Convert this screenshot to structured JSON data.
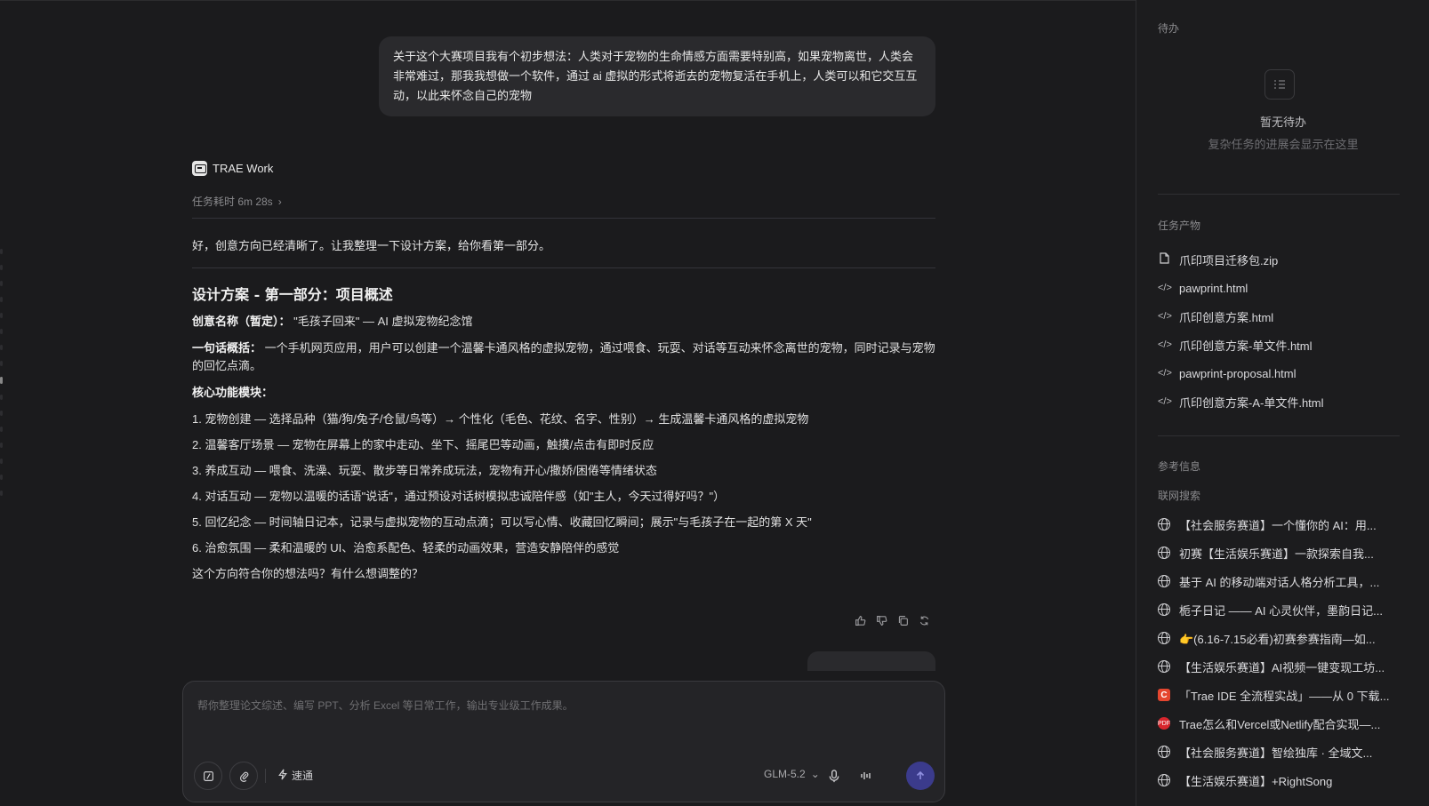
{
  "chat": {
    "user_message": "关于这个大赛项目我有个初步想法：人类对于宠物的生命情感方面需要特别高，如果宠物离世，人类会非常难过，那我我想做一个软件，通过 ai 虚拟的形式将逝去的宠物复活在手机上，人类可以和它交互互动，以此来怀念自己的宠物",
    "agent_name": "TRAE Work",
    "duration_label": "任务耗时 6m 28s",
    "intro": "好，创意方向已经清晰了。让我整理一下设计方案，给你看第一部分。",
    "doc": {
      "heading": "设计方案 - 第一部分：项目概述",
      "name_label": "创意名称（暂定）：",
      "name_value": " \"毛孩子回来\" — AI 虚拟宠物纪念馆",
      "summary_label": "一句话概括：",
      "summary_value": " 一个手机网页应用，用户可以创建一个温馨卡通风格的虚拟宠物，通过喂食、玩耍、对话等互动来怀念离世的宠物，同时记录与宠物的回忆点滴。",
      "modules_label": "核心功能模块：",
      "modules": [
        "1. 宠物创建 — 选择品种（猫/狗/兔子/仓鼠/鸟等）→ 个性化（毛色、花纹、名字、性别）→ 生成温馨卡通风格的虚拟宠物",
        "2. 温馨客厅场景 — 宠物在屏幕上的家中走动、坐下、摇尾巴等动画，触摸/点击有即时反应",
        "3. 养成互动 — 喂食、洗澡、玩耍、散步等日常养成玩法，宠物有开心/撒娇/困倦等情绪状态",
        "4. 对话互动 — 宠物以温暖的话语\"说话\"，通过预设对话树模拟忠诚陪伴感（如\"主人，今天过得好吗？\"）",
        "5. 回忆纪念 — 时间轴日记本，记录与虚拟宠物的互动点滴；可以写心情、收藏回忆瞬间；展示\"与毛孩子在一起的第 X 天\"",
        "6. 治愈氛围 — 柔和温暖的 UI、治愈系配色、轻柔的动画效果，营造安静陪伴的感觉"
      ],
      "question": "这个方向符合你的想法吗？有什么想调整的？"
    }
  },
  "composer": {
    "placeholder": "帮你整理论文综述、编写 PPT、分析 Excel 等日常工作，输出专业级工作成果。",
    "speed_label": "速通",
    "model_label": "GLM-5.2"
  },
  "side": {
    "todo_title": "待办",
    "empty_title": "暂无待办",
    "empty_sub": "复杂任务的进展会显示在这里",
    "artifacts_title": "任务产物",
    "artifacts": [
      {
        "name": "爪印项目迁移包.zip",
        "icon": "file-icon"
      },
      {
        "name": "pawprint.html",
        "icon": "code-icon"
      },
      {
        "name": "爪印创意方案.html",
        "icon": "code-icon"
      },
      {
        "name": "爪印创意方案-单文件.html",
        "icon": "code-icon"
      },
      {
        "name": "pawprint-proposal.html",
        "icon": "code-icon"
      },
      {
        "name": "爪印创意方案-A-单文件.html",
        "icon": "code-icon"
      }
    ],
    "ref_title": "参考信息",
    "ref_subtitle": "联网搜索",
    "refs": [
      {
        "title": "【社会服务赛道】一个懂你的 AI：用...",
        "icon": "globe-icon"
      },
      {
        "title": "初赛【生活娱乐赛道】一款探索自我...",
        "icon": "globe-icon"
      },
      {
        "title": "基于 AI 的移动端对话人格分析工具，...",
        "icon": "globe-icon"
      },
      {
        "title": "栀子日记 —— AI 心灵伙伴，墨韵日记...",
        "icon": "globe-icon"
      },
      {
        "title": "👉(6.16-7.15必看)初赛参赛指南—如...",
        "icon": "globe-icon"
      },
      {
        "title": "【生活娱乐赛道】AI视频一键变现工坊...",
        "icon": "globe-icon"
      },
      {
        "title": "「Trae IDE 全流程实战」——从 0 下载...",
        "icon": "csdn-icon"
      },
      {
        "title": "Trae怎么和Vercel或Netlify配合实现—...",
        "icon": "pdf-icon"
      },
      {
        "title": "【社会服务赛道】智绘独库 · 全域文...",
        "icon": "globe-icon"
      },
      {
        "title": "【生活娱乐赛道】+RightSong",
        "icon": "globe-icon"
      }
    ],
    "colors": {
      "accent": "#3b3b8c",
      "bg": "#1b1b1d",
      "panel": "#1c1c1e"
    }
  }
}
